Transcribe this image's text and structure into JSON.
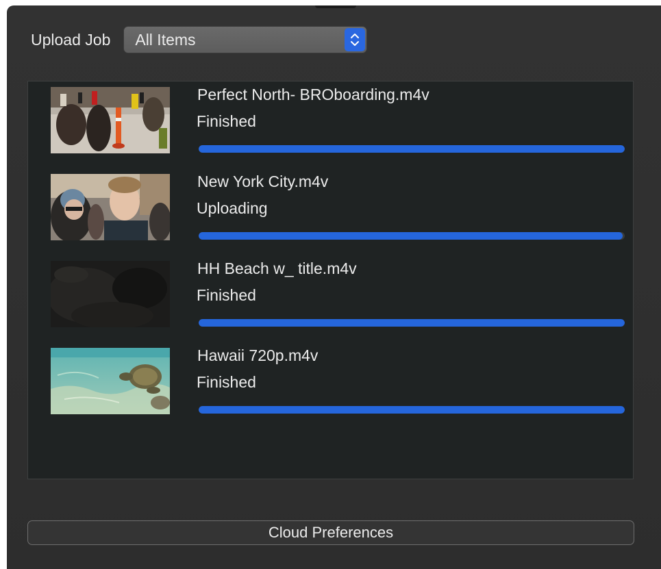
{
  "header": {
    "upload_label": "Upload Job",
    "filter_value": "All Items",
    "stepper_icon": "chevron-up-down-icon"
  },
  "items": [
    {
      "name": "Perfect North- BROboarding.m4v",
      "status": "Finished",
      "progress": 1.0,
      "thumbnail": "ski-crowd-thumbnail"
    },
    {
      "name": "New York City.m4v",
      "status": "Uploading",
      "progress": 0.995,
      "thumbnail": "street-people-thumbnail"
    },
    {
      "name": "HH Beach w_ title.m4v",
      "status": "Finished",
      "progress": 1.0,
      "thumbnail": "dark-beach-thumbnail"
    },
    {
      "name": "Hawaii 720p.m4v",
      "status": "Finished",
      "progress": 1.0,
      "thumbnail": "sea-turtle-thumbnail"
    }
  ],
  "footer": {
    "cloud_button_label": "Cloud Preferences"
  },
  "colors": {
    "accent": "#2566dc",
    "panel_bg": "#1f2323",
    "window_bg": "#313131",
    "text": "#ececec"
  }
}
